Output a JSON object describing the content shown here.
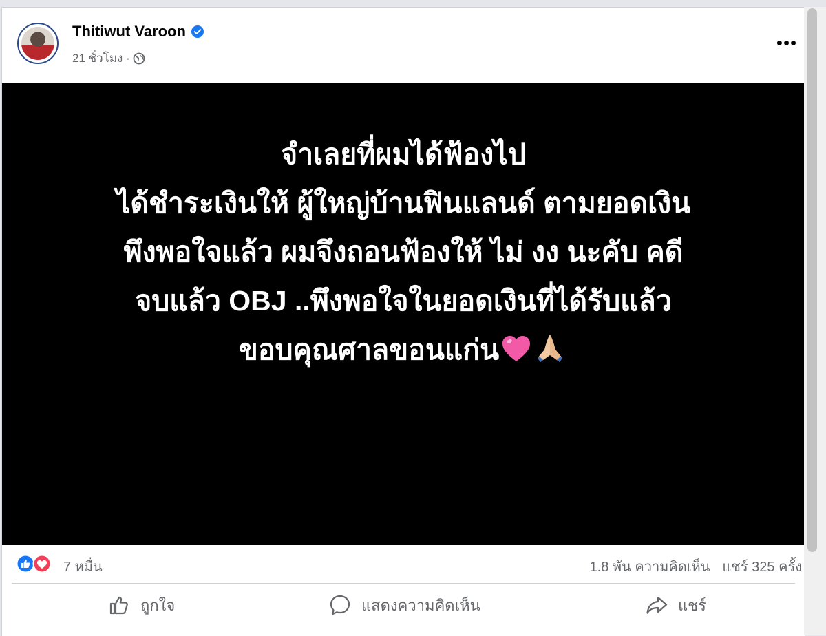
{
  "post": {
    "author": "Thitiwut Varoon",
    "time": "21 ชั่วโมง ·",
    "image_text": {
      "line1": "จำเลยที่ผมได้ฟ้องไป",
      "line2": "ได้ชำระเงินให้ ผู้ใหญ่บ้านฟินแลนด์ ตามยอดเงิน",
      "line3": "พึงพอใจแล้ว ผมจึงถอนฟ้องให้ ไม่ งง นะคับ คดี",
      "line4": "จบแล้ว OBJ ..พึงพอใจในยอดเงินที่ได้รับแล้ว",
      "line5": "ขอบคุณศาลขอนแก่น"
    },
    "reactions": {
      "count": "7 หมื่น"
    },
    "stats": {
      "comments": "1.8 พัน ความคิดเห็น",
      "shares": "แชร์ 325 ครั้ง"
    },
    "actions": {
      "like": "ถูกใจ",
      "comment": "แสดงความคิดเห็น",
      "share": "แชร์"
    }
  },
  "icons": {
    "verified": "verified-badge-icon",
    "audience": "globe-icon",
    "more": "more-options-icon",
    "reaction_like": "like-reaction-icon",
    "reaction_love": "love-reaction-icon",
    "emoji1": "pink-heart-emoji",
    "emoji2": "folded-hands-emoji"
  },
  "colors": {
    "brand_blue": "#1877f2",
    "love_red": "#f33e58",
    "image_bg": "#000000"
  }
}
